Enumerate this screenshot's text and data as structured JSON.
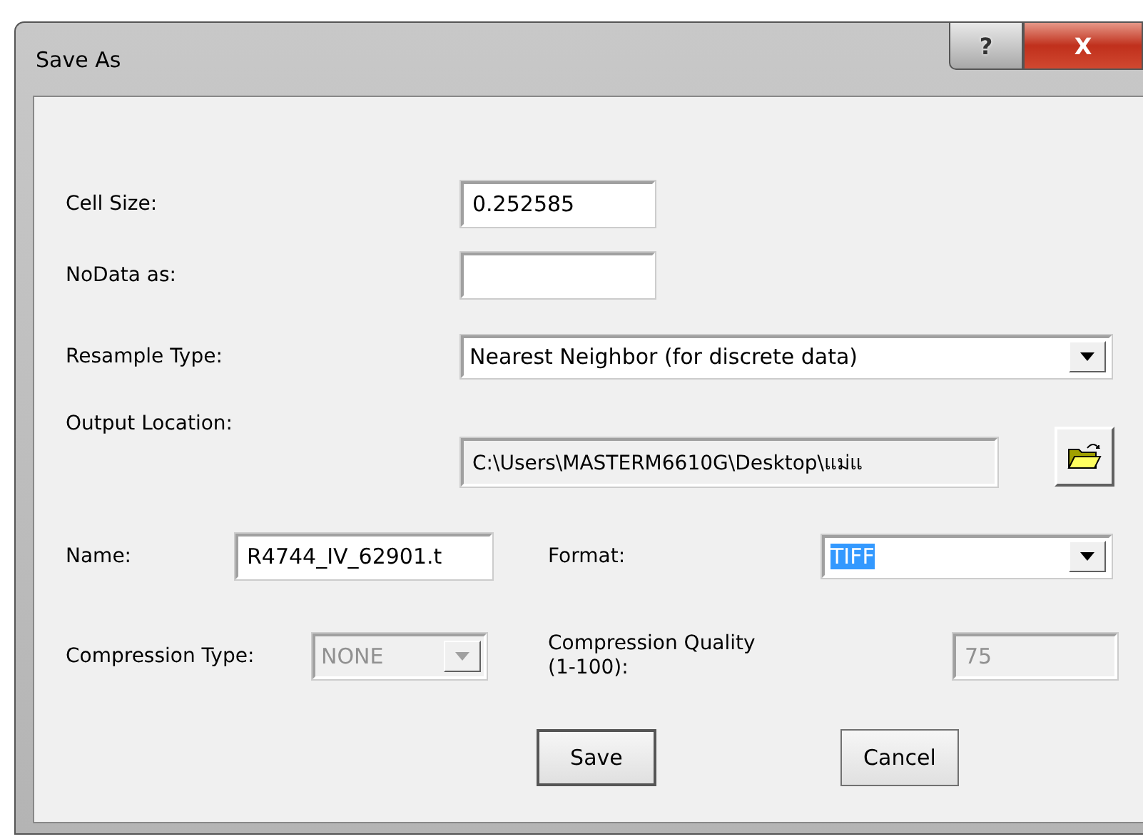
{
  "window": {
    "title": "Save As",
    "help": "?",
    "close": "X"
  },
  "cell_size": {
    "label": "Cell Size:",
    "value": "0.252585"
  },
  "nodata": {
    "label": "NoData as:"
  },
  "resample_type": {
    "label": "Resample Type:",
    "value": "Nearest Neighbor (for discrete data)"
  },
  "output_location": {
    "label": "Output Location:",
    "value": "C:\\Users\\MASTERM6610G\\Desktop\\แม่แ"
  },
  "name": {
    "label": "Name:",
    "value": "R4744_IV_62901.t"
  },
  "format": {
    "label": "Format:",
    "value": "TIFF",
    "selected": true
  },
  "compression_type": {
    "label": "Compression Type:",
    "value": "NONE",
    "disabled": true
  },
  "compression_quality": {
    "label": "Compression Quality (1-100):",
    "value": "75",
    "disabled": true
  },
  "buttons": [
    {
      "label": "Save",
      "default": true
    },
    {
      "label": "Cancel",
      "default": false
    }
  ]
}
